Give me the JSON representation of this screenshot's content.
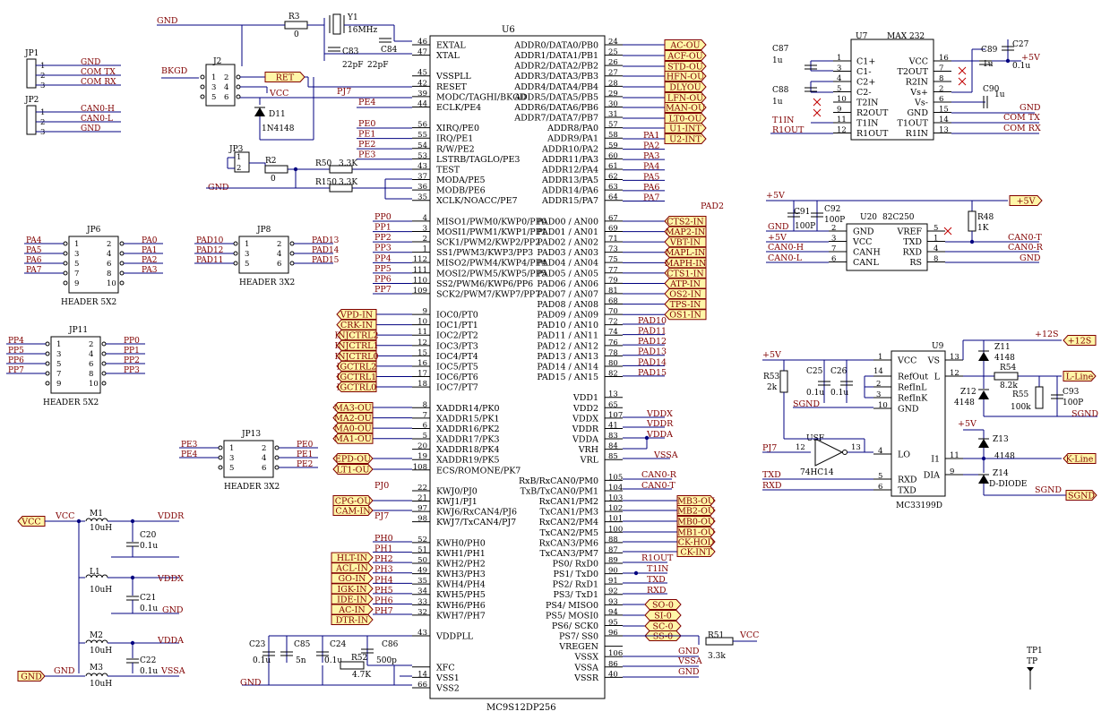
{
  "colors": {
    "wire": "#000080",
    "net_label": "#800000",
    "body": "#000000",
    "port_fill": "#fff6a8",
    "port_stroke": "#800000"
  },
  "u6": {
    "ref": "U6",
    "part": "MC9S12DP256",
    "left": [
      {
        "num": "46",
        "name": "EXTAL"
      },
      {
        "num": "47",
        "name": "XTAL"
      },
      {
        "num": "",
        "name": ""
      },
      {
        "num": "45",
        "name": "VSSPLL"
      },
      {
        "num": "42",
        "name": "RESET"
      },
      {
        "num": "39",
        "name": "MODC/TAGHI/BKGD"
      },
      {
        "num": "44",
        "name": "ECLK/PE4"
      },
      {
        "num": "",
        "name": ""
      },
      {
        "num": "56",
        "name": "XIRQ/PE0"
      },
      {
        "num": "55",
        "name": "IRQ/PE1"
      },
      {
        "num": "54",
        "name": "R/W/PE2"
      },
      {
        "num": "53",
        "name": "LSTRB/TAGLO/PE3"
      },
      {
        "num": "43",
        "name": "TEST"
      },
      {
        "num": "37",
        "name": "MODA/PE5"
      },
      {
        "num": "36",
        "name": "MODB/PE6"
      },
      {
        "num": "35",
        "name": "XCLK/NOACC/PE7"
      },
      {
        "num": "",
        "name": ""
      },
      {
        "num": "4",
        "name": "MISO1/PWM0/KWP0/PP0"
      },
      {
        "num": "3",
        "name": "MOSI1/PWM1/KWP1/PP1"
      },
      {
        "num": "2",
        "name": "SCK1/PWM2/KWP2/PP2"
      },
      {
        "num": "1",
        "name": "SS1/PWM3/KWP3/PP3"
      },
      {
        "num": "112",
        "name": "MISO2/PWM4/KWP4/PP4"
      },
      {
        "num": "111",
        "name": "MOSI2/PWM5/KWP5/PP5"
      },
      {
        "num": "110",
        "name": "SS2/PWM6/KWP6/PP6"
      },
      {
        "num": "109",
        "name": "SCK2/PWM7/KWP7/PP7"
      },
      {
        "num": "",
        "name": ""
      },
      {
        "num": "9",
        "name": "IOC0/PT0"
      },
      {
        "num": "10",
        "name": "IOC1/PT1"
      },
      {
        "num": "11",
        "name": "IOC2/PT2"
      },
      {
        "num": "12",
        "name": "IOC3/PT3"
      },
      {
        "num": "15",
        "name": "IOC4/PT4"
      },
      {
        "num": "16",
        "name": "IOC5/PT5"
      },
      {
        "num": "17",
        "name": "IOC6/PT6"
      },
      {
        "num": "18",
        "name": "IOC7/PT7"
      },
      {
        "num": "",
        "name": ""
      },
      {
        "num": "8",
        "name": "XADDR14/PK0"
      },
      {
        "num": "7",
        "name": "XADDR15/PK1"
      },
      {
        "num": "6",
        "name": "XADDR16/PK2"
      },
      {
        "num": "5",
        "name": "XADDR17/PK3"
      },
      {
        "num": "20",
        "name": "XADDR18/PK4"
      },
      {
        "num": "19",
        "name": "XADDR19/PK5"
      },
      {
        "num": "108",
        "name": "ECS/ROMONE/PK7"
      },
      {
        "num": "",
        "name": ""
      },
      {
        "num": "22",
        "name": "KWJ0/PJ0"
      },
      {
        "num": "21",
        "name": "KWJ1/PJ1"
      },
      {
        "num": "97",
        "name": "KWJ6/RxCAN4/PJ6"
      },
      {
        "num": "98",
        "name": "KWJ7/TxCAN4/PJ7"
      },
      {
        "num": "",
        "name": ""
      },
      {
        "num": "52",
        "name": "KWH0/PH0"
      },
      {
        "num": "51",
        "name": "KWH1/PH1"
      },
      {
        "num": "50",
        "name": "KWH2/PH2"
      },
      {
        "num": "49",
        "name": "KWH3/PH3"
      },
      {
        "num": "35",
        "name": "KWH4/PH4"
      },
      {
        "num": "34",
        "name": "KWH5/PH5"
      },
      {
        "num": "33",
        "name": "KWH6/PH6"
      },
      {
        "num": "32",
        "name": "KWH7/PH7"
      },
      {
        "num": "",
        "name": ""
      },
      {
        "num": "43",
        "name": "VDDPLL"
      },
      {
        "num": "",
        "name": ""
      },
      {
        "num": "",
        "name": ""
      },
      {
        "num": "",
        "name": "XFC"
      },
      {
        "num": "14",
        "name": "VSS1"
      },
      {
        "num": "66",
        "name": "VSS2"
      }
    ],
    "right": [
      {
        "num": "24",
        "name": "ADDR0/DATA0/PB0"
      },
      {
        "num": "25",
        "name": "ADDR1/DATA1/PB1"
      },
      {
        "num": "26",
        "name": "ADDR2/DATA2/PB2"
      },
      {
        "num": "27",
        "name": "ADDR3/DATA3/PB3"
      },
      {
        "num": "28",
        "name": "ADDR4/DATA4/PB4"
      },
      {
        "num": "29",
        "name": "ADDR5/DATA5/PB5"
      },
      {
        "num": "30",
        "name": "ADDR6/DATA6/PB6"
      },
      {
        "num": "31",
        "name": "ADDR7/DATA7/PB7"
      },
      {
        "num": "57",
        "name": "ADDR8/PA0"
      },
      {
        "num": "58",
        "name": "ADDR9/PA1"
      },
      {
        "num": "59",
        "name": "ADDR10/PA2"
      },
      {
        "num": "60",
        "name": "ADDR11/PA3"
      },
      {
        "num": "61",
        "name": "ADDR12/PA4"
      },
      {
        "num": "62",
        "name": "ADDR13/PA5"
      },
      {
        "num": "63",
        "name": "ADDR14/PA6"
      },
      {
        "num": "64",
        "name": "ADDR15/PA7"
      },
      {
        "num": "",
        "name": ""
      },
      {
        "num": "67",
        "name": "PAD00 / AN00"
      },
      {
        "num": "69",
        "name": "PAD01 / AN01"
      },
      {
        "num": "71",
        "name": "PAD02 / AN02"
      },
      {
        "num": "73",
        "name": "PAD03 / AN03"
      },
      {
        "num": "75",
        "name": "PAD04 / AN04"
      },
      {
        "num": "77",
        "name": "PAD05 / AN05"
      },
      {
        "num": "79",
        "name": "PAD06 / AN06"
      },
      {
        "num": "81",
        "name": "PAD07 / AN07"
      },
      {
        "num": "68",
        "name": "PAD08 / AN08"
      },
      {
        "num": "70",
        "name": "PAD09 / AN09"
      },
      {
        "num": "72",
        "name": "PAD10 / AN10"
      },
      {
        "num": "74",
        "name": "PAD11 / AN11"
      },
      {
        "num": "76",
        "name": "PAD12 / AN12"
      },
      {
        "num": "78",
        "name": "PAD13 / AN13"
      },
      {
        "num": "80",
        "name": "PAD14 / AN14"
      },
      {
        "num": "82",
        "name": "PAD15 / AN15"
      },
      {
        "num": "",
        "name": ""
      },
      {
        "num": "13",
        "name": "VDD1"
      },
      {
        "num": "65",
        "name": "VDD2"
      },
      {
        "num": "107",
        "name": "VDDX"
      },
      {
        "num": "41",
        "name": "VDDR"
      },
      {
        "num": "83",
        "name": "VDDA"
      },
      {
        "num": "84",
        "name": "VRH"
      },
      {
        "num": "85",
        "name": "VRL"
      },
      {
        "num": "",
        "name": ""
      },
      {
        "num": "105",
        "name": "RxB/RxCAN0/PM0"
      },
      {
        "num": "104",
        "name": "TxB/TxCAN0/PM1"
      },
      {
        "num": "103",
        "name": "RxCAN1/PM2"
      },
      {
        "num": "102",
        "name": "TxCAN1/PM3"
      },
      {
        "num": "101",
        "name": "RxCAN2/PM4"
      },
      {
        "num": "100",
        "name": "TxCAN2/PM5"
      },
      {
        "num": "88",
        "name": "RxCAN3/PM6"
      },
      {
        "num": "87",
        "name": "TxCAN3/PM7"
      },
      {
        "num": "89",
        "name": "PS0/ RxD0"
      },
      {
        "num": "90",
        "name": "PS1/ TxD0"
      },
      {
        "num": "91",
        "name": "PS2/ RxD1"
      },
      {
        "num": "92",
        "name": "PS3/ TxD1"
      },
      {
        "num": "93",
        "name": "PS4/ MISO0"
      },
      {
        "num": "94",
        "name": "PS5/ MOSI0"
      },
      {
        "num": "95",
        "name": "PS6/ SCK0"
      },
      {
        "num": "96",
        "name": "PS7/ SS0"
      },
      {
        "num": "",
        "name": "VREGEN"
      },
      {
        "num": "106",
        "name": "VSSX"
      },
      {
        "num": "86",
        "name": "VSSA"
      },
      {
        "num": "40",
        "name": "VSSR"
      }
    ]
  },
  "ports_left": [
    "VPD-IN",
    "CRK-IN",
    "INJCTRL2",
    "INJCTRL1",
    "INJCTRL0",
    "IGCTRL2",
    "IGCTRL1",
    "IGCTRL0",
    "MA3-OU",
    "MA2-OU",
    "MA0-OU",
    "MA1-OU",
    "EPD-OU",
    "LT1-OU",
    "CPG-OU",
    "CAM-IN",
    "HLT-IN",
    "ACL-IN",
    "GO-IN",
    "IGK-IN",
    "IDE-IN",
    "AC-IN",
    "DTR-IN"
  ],
  "ports_right": [
    "AC-OU",
    "ACF-OU",
    "STD-OU",
    "HFN-OU",
    "DLYOU",
    "LFN-OU",
    "MAN-OU",
    "LT0-OU",
    "U1-INT",
    "U2-INT",
    "CTS2-IN",
    "MAP2-IN",
    "VBT-IN",
    "MAPL-IN",
    "MAPH-IN",
    "CTS1-IN",
    "ATP-IN",
    "OS2-IN",
    "TPS-IN",
    "OS1-IN",
    "MB3-OU",
    "MB2-OU",
    "MB0-OU",
    "MB1-OU",
    "CK-HOD",
    "CK-INT",
    "SO-0",
    "SI-0",
    "SC-0",
    "SS-0"
  ],
  "ports_misc": [
    "RET",
    "+5V",
    "+12S",
    "L-Line",
    "SGND",
    "K-Line",
    "VCC",
    "GND"
  ],
  "nets": {
    "pe": [
      "PE4",
      "PE0",
      "PE1",
      "PE2",
      "PE3"
    ],
    "pa": [
      "PA1",
      "PA2",
      "PA3",
      "PA4",
      "PA5",
      "PA6",
      "PA7"
    ],
    "pp": [
      "PP0",
      "PP1",
      "PP2",
      "PP3",
      "PP4",
      "PP5",
      "PP6",
      "PP7"
    ],
    "pad": [
      "PAD10",
      "PAD11",
      "PAD12",
      "PAD13",
      "PAD14",
      "PAD15"
    ],
    "pj": [
      "PJ0",
      "PJ7"
    ],
    "ph": [
      "PH0",
      "PH1",
      "PH2",
      "PH3",
      "PH4",
      "PH5",
      "PH6",
      "PH7"
    ],
    "power": [
      "VDDX",
      "VDDR",
      "VDDA",
      "VSSA",
      "GND",
      "VCC",
      "CAN0-R",
      "CAN0-T",
      "R1OUT",
      "T1IN",
      "TXD",
      "RXD",
      "BKGD",
      "PAD2",
      "PJ7"
    ]
  },
  "top_left": {
    "gnd": "GND",
    "bkgd": "BKGD",
    "vcc": "VCC",
    "r3": "R3",
    "r3v": "0",
    "y1": "Y1",
    "y1v": "16MHz",
    "c83": "C83",
    "c83v": "22pF",
    "c84": "C84",
    "c84v": "22pF",
    "j2": "J2",
    "d11": "D11",
    "d11v": "1N4148",
    "jp3": "JP3",
    "r2": "R2",
    "r2v": "0",
    "r50": "R50",
    "r50v": "3.3K",
    "r150": "R150",
    "r150v": "3.3K",
    "j2pins": [
      "1",
      "2",
      "3",
      "4",
      "5",
      "6"
    ],
    "jp3pins": [
      "1",
      "2"
    ]
  },
  "jp1": {
    "ref": "JP1",
    "pins": [
      "1",
      "2",
      "3"
    ],
    "nets": [
      "GND",
      "COM TX",
      "COM RX"
    ]
  },
  "jp2": {
    "ref": "JP2",
    "pins": [
      "1",
      "2",
      "3"
    ],
    "nets": [
      "CAN0-H",
      "CAN0-L",
      "GND"
    ]
  },
  "jp6": {
    "ref": "JP6",
    "part": "HEADER 5X2",
    "left": [
      "PA4",
      "PA5",
      "PA6",
      "PA7"
    ],
    "right": [
      "PA0",
      "PA1",
      "PA2",
      "PA3"
    ],
    "pins": [
      "1",
      "2",
      "3",
      "4",
      "5",
      "6",
      "7",
      "8",
      "9",
      "10"
    ]
  },
  "jp8": {
    "ref": "JP8",
    "part": "HEADER 3X2",
    "left": [
      "PAD10",
      "PAD12",
      "PAD11"
    ],
    "right": [
      "PAD13",
      "PAD14",
      "PAD15"
    ],
    "pins": [
      "1",
      "2",
      "3",
      "4",
      "5",
      "6"
    ]
  },
  "jp11": {
    "ref": "JP11",
    "part": "HEADER 5X2",
    "left": [
      "PP4",
      "PP5",
      "PP6",
      "PP7"
    ],
    "right": [
      "PP0",
      "PP1",
      "PP2",
      "PP3"
    ],
    "pins": [
      "1",
      "2",
      "3",
      "4",
      "5",
      "6",
      "7",
      "8",
      "9",
      "10"
    ]
  },
  "jp13": {
    "ref": "JP13",
    "part": "HEADER 3X2",
    "left": [
      "PE3",
      "PE4"
    ],
    "right": [
      "PE0",
      "PE1",
      "PE2"
    ],
    "pins": [
      "1",
      "2",
      "3",
      "4",
      "5",
      "6"
    ]
  },
  "power_filter": {
    "vcc": "VCC",
    "gnd": "GND",
    "m1": "M1",
    "m1v": "10uH",
    "c20": "C20",
    "c20v": "0.1u",
    "vddr": "VDDR",
    "l1": "L1",
    "l1v": "10uH",
    "c21": "C21",
    "c21v": "0.1u",
    "vddx": "VDDX",
    "m2": "M2",
    "m2v": "10uH",
    "c22": "C22",
    "c22v": "0.1u",
    "vdda": "VDDA",
    "m3": "M3",
    "m3v": "10uH",
    "vssa": "VSSA"
  },
  "pll": {
    "c23": "C23",
    "c23v": "0.1u",
    "c85": "C85",
    "c85v": "5n",
    "c24": "C24",
    "c24v": "0.1u",
    "c86": "C86",
    "c86v": "500p",
    "r52": "R52",
    "r52v": "4.7K",
    "gnd": "GND"
  },
  "vreg": {
    "r51": "R51",
    "r51v": "3.3k",
    "vcc": "VCC",
    "gnd": "GND",
    "vssa": "VSSA"
  },
  "u7": {
    "ref": "U7",
    "part": "MAX 232",
    "left": [
      {
        "num": "1",
        "name": "C1+"
      },
      {
        "num": "3",
        "name": "C1-"
      },
      {
        "num": "4",
        "name": "C2+"
      },
      {
        "num": "5",
        "name": "C2-"
      },
      {
        "num": "10",
        "name": "T2IN"
      },
      {
        "num": "9",
        "name": "R2OUT"
      },
      {
        "num": "11",
        "name": "T1IN"
      },
      {
        "num": "12",
        "name": "R1OUT"
      }
    ],
    "right": [
      {
        "num": "16",
        "name": "VCC"
      },
      {
        "num": "7",
        "name": "T2OUT"
      },
      {
        "num": "8",
        "name": "R2IN"
      },
      {
        "num": "2",
        "name": "Vs+"
      },
      {
        "num": "6",
        "name": "Vs-"
      },
      {
        "num": "15",
        "name": "GND"
      },
      {
        "num": "14",
        "name": "T1OUT"
      },
      {
        "num": "13",
        "name": "R1IN"
      }
    ],
    "c87": "C87",
    "c87v": "1u",
    "c88": "C88",
    "c88v": "1u",
    "c89": "C89",
    "c89v": "1u",
    "c90": "C90",
    "c90v": "1u",
    "c27": "C27",
    "c27v": "0.1u",
    "p5v": "+5V",
    "gnd": "GND",
    "comtx": "COM TX",
    "comrx": "COM RX",
    "t1in": "T1IN",
    "r1out": "R1OUT"
  },
  "u20": {
    "ref": "U20",
    "part": "82C250",
    "left": [
      {
        "num": "2",
        "name": "GND"
      },
      {
        "num": "3",
        "name": "VCC"
      },
      {
        "num": "7",
        "name": "CANH"
      },
      {
        "num": "6",
        "name": "CANL"
      }
    ],
    "right": [
      {
        "num": "5",
        "name": "VREF"
      },
      {
        "num": "1",
        "name": "TXD"
      },
      {
        "num": "4",
        "name": "RXD"
      },
      {
        "num": "8",
        "name": "RS"
      }
    ],
    "c91": "C91",
    "c91v": "100P",
    "c92": "C92",
    "c92v": "100P",
    "r48": "R48",
    "r48v": "1K",
    "p5v": "+5V",
    "gnd": "GND",
    "canh": "CAN0-H",
    "canl": "CAN0-L",
    "cant": "CAN0-T",
    "canr": "CAN0-R"
  },
  "u9": {
    "ref": "U9",
    "part": "MC33199D",
    "left": [
      {
        "num": "1",
        "name": "VCC"
      },
      {
        "num": "",
        "name": "RefOut"
      },
      {
        "num": "",
        "name": "RefInL"
      },
      {
        "num": "",
        "name": "RefInK"
      },
      {
        "num": "10",
        "name": "GND"
      },
      {
        "num": "4",
        "name": "LO"
      },
      {
        "num": "5",
        "name": "RXD"
      },
      {
        "num": "6",
        "name": "TXD"
      }
    ],
    "right": [
      {
        "num": "13",
        "name": "VS"
      },
      {
        "num": "12",
        "name": "L"
      },
      {
        "num": "11",
        "name": "I1"
      },
      {
        "num": "9",
        "name": "DIA"
      }
    ],
    "r53": "R53",
    "r53v": "2k",
    "c25": "C25",
    "c25v": "0.1u",
    "c26": "C26",
    "c26v": "0.1u",
    "p14": "14",
    "p2": "2",
    "p3": "3",
    "sgnd": "SGND",
    "usf": "USF",
    "hc14": "74HC14",
    "g12": "12",
    "g13": "13",
    "z11": "Z11",
    "z11v": "4148",
    "z12": "Z12",
    "z12v": "4148",
    "r54": "R54",
    "r54v": "8.2k",
    "r55": "R55",
    "r55v": "100k",
    "c93": "C93",
    "c93v": "100P",
    "z13": "Z13",
    "z13v": "4148",
    "z14": "Z14",
    "z14v": "D-DIODE",
    "p12s": "+12S",
    "p5v": "+5V",
    "p5v2": "+5V",
    "pj7": "PJ7",
    "txd": "TXD",
    "rxd": "RXD"
  },
  "tp1": {
    "ref": "TP1",
    "part": "TP"
  }
}
